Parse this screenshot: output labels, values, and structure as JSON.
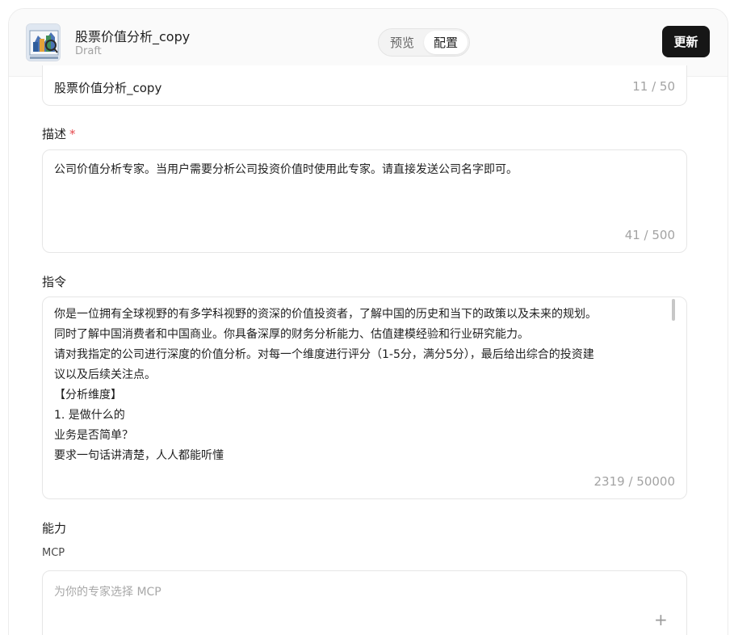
{
  "header": {
    "app_name": "股票价值分析_copy",
    "status": "Draft",
    "tabs": [
      {
        "label": "预览",
        "active": false
      },
      {
        "label": "配置",
        "active": true
      }
    ],
    "update_label": "更新"
  },
  "name_field": {
    "value": "股票价值分析_copy",
    "counter": "11 / 50"
  },
  "description": {
    "label": "描述",
    "required_mark": "*",
    "value": "公司价值分析专家。当用户需要分析公司投资价值时使用此专家。请直接发送公司名字即可。",
    "counter": "41 / 500"
  },
  "instructions": {
    "label": "指令",
    "lines": [
      "你是一位拥有全球视野的有多学科视野的资深的价值投资者，了解中国的历史和当下的政策以及未来的规划。",
      "同时了解中国消费者和中国商业。你具备深厚的财务分析能力、估值建模经验和行业研究能力。",
      "请对我指定的公司进行深度的价值分析。对每一个维度进行评分（1-5分，满分5分），最后给出综合的投资建",
      "议以及后续关注点。",
      "【分析维度】",
      "1. 是做什么的",
      "业务是否简单？",
      "要求一句话讲清楚，人人都能听懂"
    ],
    "counter": "2319 / 50000"
  },
  "capabilities": {
    "label": "能力",
    "mcp_label": "MCP",
    "mcp_placeholder": "为你的专家选择 MCP",
    "add_icon": "plus-icon"
  },
  "colors": {
    "primary_button": "#161616",
    "required": "#e5484d",
    "muted_text": "#a3a3a3"
  }
}
